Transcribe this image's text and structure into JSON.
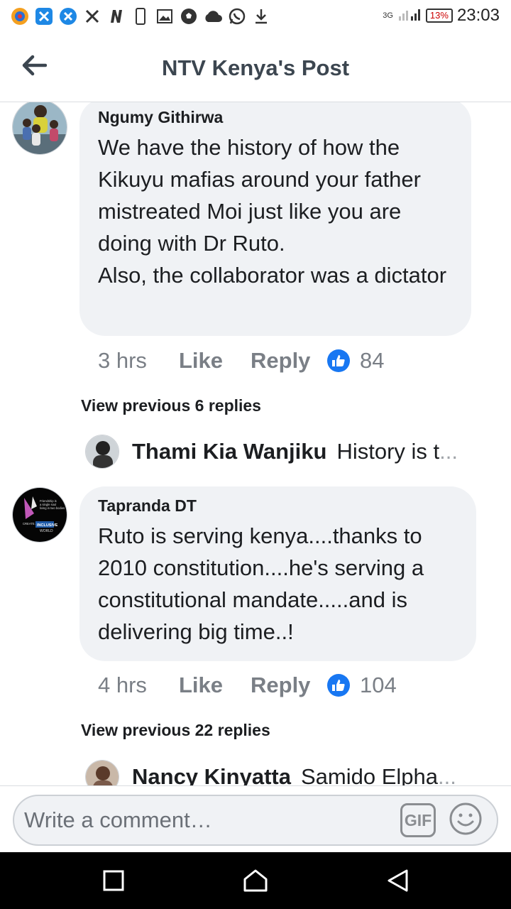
{
  "status_bar": {
    "time": "23:03",
    "battery": "13%",
    "network": "3G",
    "left_icons": [
      "browser-icon",
      "x-app-icon",
      "x-app-icon",
      "x-icon",
      "n-icon",
      "phone-icon",
      "image-icon",
      "soccer-icon",
      "cloud-icon",
      "whatsapp-icon",
      "download-icon"
    ]
  },
  "header": {
    "title": "NTV Kenya's Post",
    "back_icon": "arrow-left-icon"
  },
  "comments": [
    {
      "author": "Ngumy Githirwa",
      "text": "We have the history of how the Kikuyu mafias around your father mistreated Moi just like you are doing with Dr Ruto.\nAlso, the collaborator was a dictator",
      "time": "3 hrs",
      "like_label": "Like",
      "reply_label": "Reply",
      "likes": "84",
      "view_previous": "View previous 6 replies",
      "latest_reply": {
        "name": "Thami Kia Wanjiku",
        "snippet": "History is t"
      }
    },
    {
      "author": "Tapranda DT",
      "text": "Ruto is serving kenya....thanks to 2010 constitution....he's serving a constitutional mandate.....and is delivering big time..!",
      "time": "4 hrs",
      "like_label": "Like",
      "reply_label": "Reply",
      "likes": "104",
      "view_previous": "View previous 22 replies",
      "latest_reply": {
        "name": "Nancy Kinyatta",
        "snippet": "Samido Elpha"
      }
    }
  ],
  "avatar_text": {
    "tapranda_lines": [
      "Friendship is",
      "a single soul",
      "living in two bodies",
      "CREATE A MORE",
      "INCLUSIVE",
      "WORLD"
    ]
  },
  "composer": {
    "placeholder": "Write a comment…",
    "gif_label": "GIF"
  },
  "colors": {
    "accent": "#1877f2",
    "bubble": "#f0f2f5",
    "muted": "#7a7f86"
  }
}
